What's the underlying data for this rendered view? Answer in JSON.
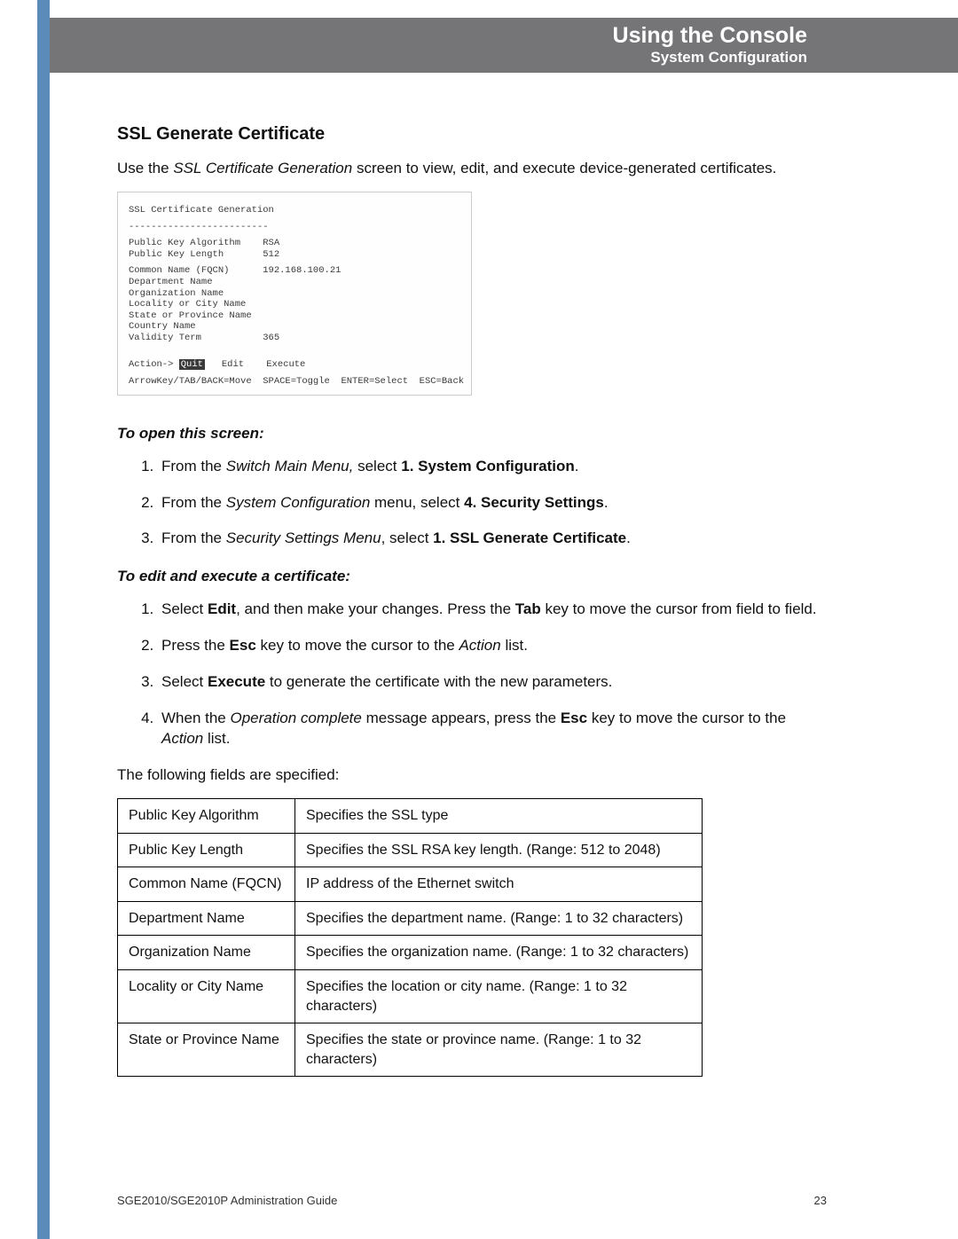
{
  "header": {
    "chapter": "Using the Console",
    "section": "System Configuration"
  },
  "title": "SSL Generate Certificate",
  "intro": {
    "prefix": "Use the ",
    "screen_name": "SSL Certificate Generation",
    "suffix": " screen to view, edit, and execute device-generated certificates."
  },
  "console": {
    "title": "SSL Certificate Generation",
    "sep": "-------------------------",
    "rows": [
      {
        "label": "Public Key Algorithm",
        "value": "RSA"
      },
      {
        "label": "Public Key Length",
        "value": "512"
      },
      {
        "label": "",
        "value": ""
      },
      {
        "label": "Common Name (FQCN)",
        "value": "192.168.100.21"
      },
      {
        "label": "Department Name",
        "value": ""
      },
      {
        "label": "Organization Name",
        "value": ""
      },
      {
        "label": "Locality or City Name",
        "value": ""
      },
      {
        "label": "State or Province Name",
        "value": ""
      },
      {
        "label": "Country Name",
        "value": ""
      },
      {
        "label": "Validity Term",
        "value": "365"
      }
    ],
    "action_prefix": "Action-> ",
    "action_selected": "Quit",
    "action_rest": "   Edit    Execute",
    "help": "ArrowKey/TAB/BACK=Move  SPACE=Toggle  ENTER=Select  ESC=Back"
  },
  "sub_open": "To open this screen:",
  "open_steps": [
    {
      "t1": "From the ",
      "i1": "Switch Main Menu, ",
      "t2": "select ",
      "b1": "1. System Configuration",
      "t3": "."
    },
    {
      "t1": "From the ",
      "i1": "System Configuration",
      "t2": " menu, select ",
      "b1": "4. Security Settings",
      "t3": "."
    },
    {
      "t1": "From the ",
      "i1": "Security Settings Menu",
      "t2": ", select ",
      "b1": "1. SSL Generate Certificate",
      "t3": "."
    }
  ],
  "sub_edit": "To edit and execute a certificate:",
  "edit_steps": {
    "s1": {
      "a": "Select ",
      "b": "Edit",
      "c": ", and then make your changes. Press the ",
      "d": "Tab",
      "e": " key to move the cursor from field to field."
    },
    "s2": {
      "a": "Press the ",
      "b": "Esc",
      "c": " key to move the cursor to the ",
      "d": "Action",
      "e": " list."
    },
    "s3": {
      "a": "Select ",
      "b": "Execute",
      "c": " to generate the certificate with the new parameters."
    },
    "s4": {
      "a": "When the ",
      "b": "Operation complete",
      "c": " message appears, press the ",
      "d": "Esc",
      "e": " key to move the cursor to the ",
      "f": "Action",
      "g": " list."
    }
  },
  "fields_intro": "The following fields are specified:",
  "fields": [
    {
      "name": "Public Key Algorithm",
      "desc": "Specifies the SSL type"
    },
    {
      "name": "Public Key Length",
      "desc": "Specifies the SSL RSA key length. (Range: 512 to 2048)"
    },
    {
      "name": "Common Name (FQCN)",
      "desc": "IP address of the Ethernet switch"
    },
    {
      "name": "Department Name",
      "desc": "Specifies the department name. (Range: 1 to 32 characters)"
    },
    {
      "name": "Organization Name",
      "desc": "Specifies the organization name. (Range: 1 to 32 characters)"
    },
    {
      "name": "Locality or City Name",
      "desc": "Specifies the location or city name. (Range: 1 to 32 characters)"
    },
    {
      "name": "State or Province Name",
      "desc": "Specifies the state or province name. (Range: 1 to 32 characters)"
    }
  ],
  "footer": {
    "guide": "SGE2010/SGE2010P Administration Guide",
    "page": "23"
  }
}
